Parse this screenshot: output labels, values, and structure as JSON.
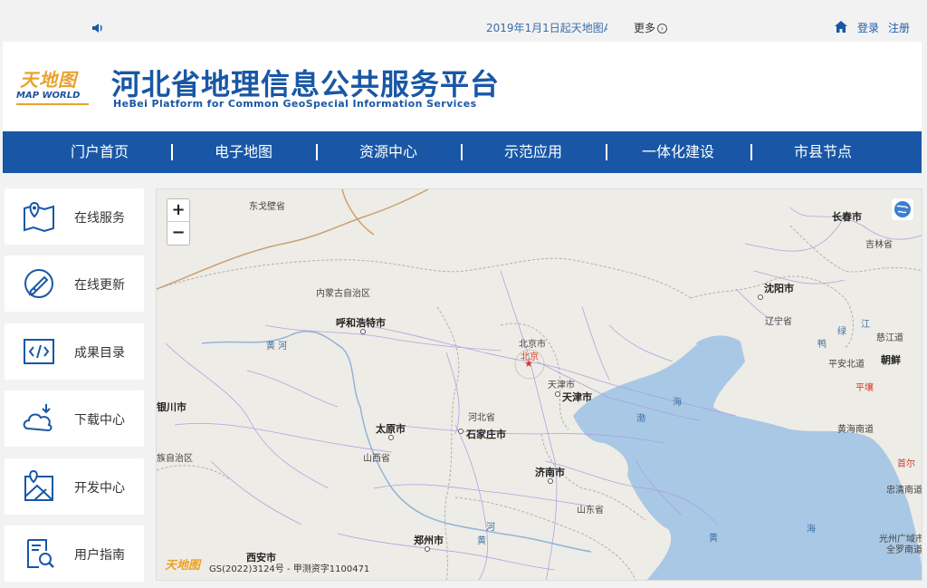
{
  "topbar": {
    "notice": "2019年1月1日起天地图A",
    "more_label": "更多",
    "more_icon": "chevron-right-circle-icon",
    "login": "登录",
    "register": "注册"
  },
  "header": {
    "logo_cn": "天地图",
    "logo_en": "MAP WORLD",
    "title_cn": "河北省地理信息公共服务平台",
    "title_en": "HeBei Platform for Common GeoSpecial Information Services"
  },
  "nav": {
    "items": [
      "门户首页",
      "电子地图",
      "资源中心",
      "示范应用",
      "一体化建设",
      "市县节点"
    ]
  },
  "sidebar": {
    "items": [
      {
        "label": "在线服务",
        "icon": "map-pin-icon"
      },
      {
        "label": "在线更新",
        "icon": "edit-circle-icon"
      },
      {
        "label": "成果目录",
        "icon": "code-icon"
      },
      {
        "label": "下载中心",
        "icon": "cloud-download-icon"
      },
      {
        "label": "开发中心",
        "icon": "map-develop-icon"
      },
      {
        "label": "用户指南",
        "icon": "guide-doc-icon"
      }
    ]
  },
  "map": {
    "zoom_in": "+",
    "zoom_out": "−",
    "attribution_logo": "天地图",
    "attribution": "GS(2022)3124号 - 甲测资字1100471",
    "labels": {
      "dongge": "东戈壁省",
      "neimeng": "内蒙古自治区",
      "huhehaote": "呼和浩特市",
      "huanghe": "黄  河",
      "beijing_city": "北京市",
      "beijing": "北京",
      "tianjin_city": "天津市",
      "tianjin": "天津市",
      "hebei": "河北省",
      "shijiazhuang": "石家庄市",
      "taiyuan": "太原市",
      "shanxi": "山西省",
      "yinchuan": "银川市",
      "ningxia": "族自治区",
      "jinan": "济南市",
      "shandong": "山东省",
      "zhengzhou": "郑州市",
      "xian": "西安市",
      "he": "河",
      "huang2": "黄",
      "changchun": "长春市",
      "jilin": "吉林省",
      "shenyang": "沈阳市",
      "liaoning": "辽宁省",
      "lv": "绿",
      "jiang": "江",
      "ya": "鸭",
      "cijiang": "慈江道",
      "chaoxian": "朝鲜",
      "pingan": "平安北道",
      "pingrang": "平壤",
      "huanghai_nan": "黄海南道",
      "shouer": "首尔",
      "zhongqing": "忠清南道",
      "guangzhou": "光州广域市",
      "quanluo": "全罗南道",
      "hai1": "海",
      "bo": "渤",
      "hai2": "海",
      "huang3": "黄",
      "hai3": "海"
    }
  }
}
